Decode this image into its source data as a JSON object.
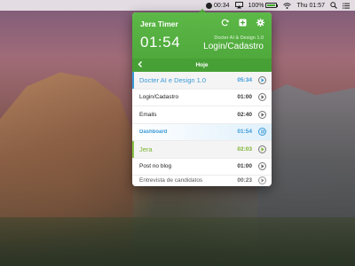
{
  "menubar": {
    "timer": "00:34",
    "battery": "100%",
    "clock": "Thu 01:57"
  },
  "app": {
    "title": "Jera Timer",
    "elapsed": "01:54",
    "current_project": "Docter AI & Design 1.0",
    "current_task": "Login/Cadastro",
    "day_label": "Hoje"
  },
  "entries": [
    {
      "name": "Docter AI e Design 1.0",
      "time": "05:34",
      "kind": "project-blue"
    },
    {
      "name": "Login/Cadastro",
      "time": "01:00",
      "kind": "task"
    },
    {
      "name": "Emails",
      "time": "02:40",
      "kind": "task"
    },
    {
      "name": "Dashboard",
      "time": "01:54",
      "kind": "active"
    },
    {
      "name": "Jera",
      "time": "02:03",
      "kind": "project-green"
    },
    {
      "name": "Post no blog",
      "time": "01:00",
      "kind": "task"
    },
    {
      "name": "Entrevista de candidatos",
      "time": "00:23",
      "kind": "task"
    }
  ],
  "colors": {
    "header_green": "#5cb847",
    "accent_blue": "#3a9ad9",
    "project_green": "#7ab32f"
  }
}
